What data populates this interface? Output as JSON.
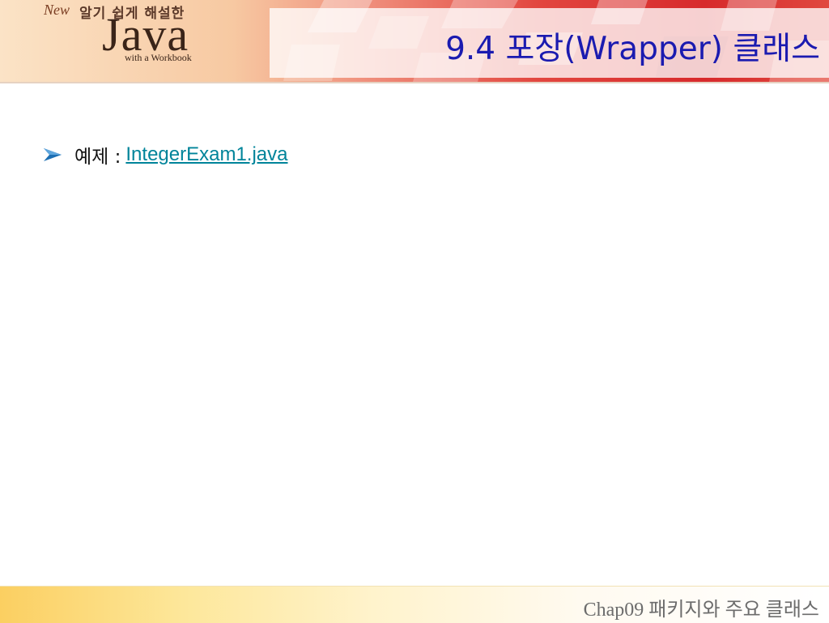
{
  "header": {
    "logo": {
      "new": "New",
      "subtitle": "알기 쉽게 해설한",
      "name": "Java",
      "tagline": "with a Workbook"
    },
    "title": "9.4 포장(Wrapper) 클래스"
  },
  "content": {
    "items": [
      {
        "label": "예제 :",
        "link": "IntegerExam1.java"
      }
    ]
  },
  "footer": {
    "text": "Chap09 패키지와 주요 클래스"
  },
  "colors": {
    "title": "#1b1bb0",
    "link": "#00849a",
    "bullet": "#1d6fb3",
    "footer_text": "#6c6c6c"
  },
  "icons": {
    "bullet": "arrow-bullet-icon"
  }
}
